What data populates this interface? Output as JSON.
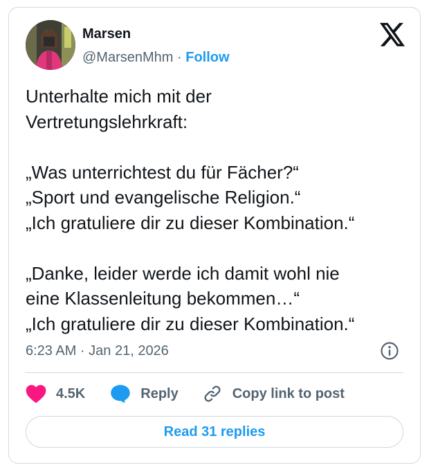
{
  "author": {
    "name": "Marsen",
    "handle": "@MarsenMhm",
    "separator": "·",
    "follow_label": "Follow"
  },
  "tweet": {
    "paragraphs": [
      "Unterhalte mich mit der\nVertretungslehrkraft:",
      "„Was unterrichtest du für Fächer?“\n„Sport und evangelische Religion.“\n„Ich gratuliere dir zu dieser Kombination.“",
      "„Danke, leider werde ich damit wohl nie\neine Klassenleitung bekommen…“\n„Ich gratuliere dir zu dieser Kombination.“"
    ],
    "timestamp": "6:23 AM · Jan 21, 2026"
  },
  "actions": {
    "like_count": "4.5K",
    "reply_label": "Reply",
    "copy_label": "Copy link to post"
  },
  "footer": {
    "read_replies_label": "Read 31 replies"
  },
  "icons": {
    "logo": "x-logo-icon",
    "info": "info-icon",
    "like": "heart-icon",
    "reply": "speech-bubble-icon",
    "copy": "link-icon"
  },
  "colors": {
    "accent": "#1d9bf0",
    "like": "#f91880",
    "text": "#0f1419",
    "muted": "#536471",
    "border": "#cfd9de"
  }
}
